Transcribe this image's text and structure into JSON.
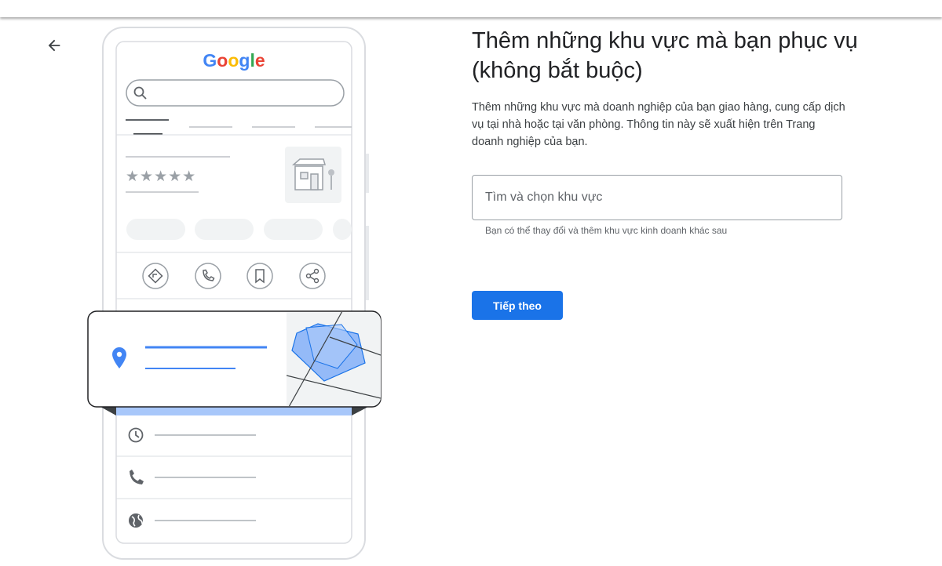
{
  "page": {
    "title": "Thêm những khu vực mà bạn phục vụ (không bắt buộc)",
    "description": "Thêm những khu vực mà doanh nghiệp của bạn giao hàng, cung cấp dịch vụ tại nhà hoặc tại văn phòng. Thông tin này sẽ xuất hiện trên Trang doanh nghiệp của bạn."
  },
  "search_field": {
    "placeholder": "Tìm và chọn khu vực",
    "value": "",
    "helper_text": "Bạn có thể thay đổi và thêm khu vực kinh doanh khác sau"
  },
  "actions": {
    "next_label": "Tiếp theo"
  },
  "illustration": {
    "logo_text": "Google",
    "rating_stars": "★★★★★",
    "logo_colors": [
      "#4285F4",
      "#EA4335",
      "#FBBC05",
      "#4285F4",
      "#34A853",
      "#EA4335"
    ]
  },
  "colors": {
    "accent": "#1a73e8",
    "map_area": "#8ab4f8",
    "pin": "#4285f4"
  }
}
